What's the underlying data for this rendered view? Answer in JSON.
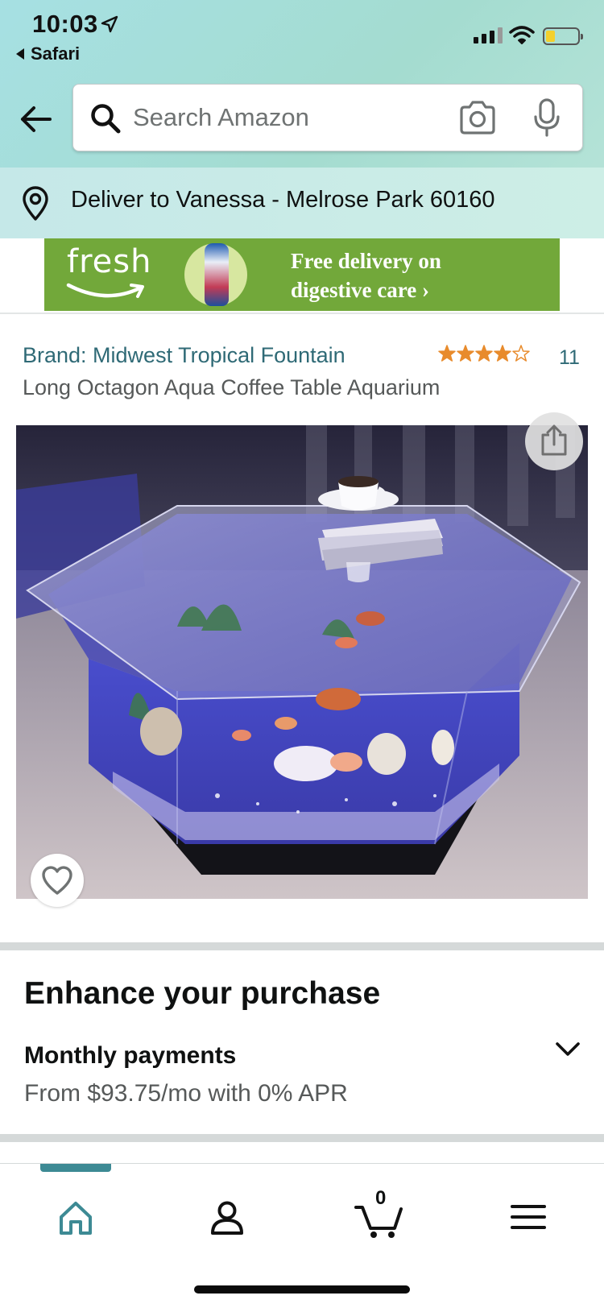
{
  "status_bar": {
    "time": "10:03",
    "back_app": "Safari"
  },
  "search": {
    "placeholder": "Search Amazon"
  },
  "delivery": {
    "text": "Deliver to Vanessa - Melrose Park 60160"
  },
  "banner": {
    "logo_text": "fresh",
    "line1": "Free delivery on",
    "line2": "digestive care ›",
    "colors": {
      "background": "#72a83a"
    }
  },
  "product": {
    "brand": "Brand: Midwest Tropical Fountain",
    "title": "Long Octagon Aqua Coffee Table Aquarium",
    "rating_stars": 4,
    "rating_max": 5,
    "rating_count": "11"
  },
  "enhance": {
    "heading": "Enhance your purchase",
    "monthly_title": "Monthly payments",
    "monthly_sub": "From $93.75/mo with 0% APR"
  },
  "bottom_nav": {
    "items": [
      {
        "icon": "home-icon",
        "active": true
      },
      {
        "icon": "account-icon",
        "active": false
      },
      {
        "icon": "cart-icon",
        "active": false
      },
      {
        "icon": "menu-icon",
        "active": false
      }
    ],
    "cart_count": "0"
  },
  "colors": {
    "link": "#2f6a76",
    "star": "#e88b2c",
    "accent": "#3d8a94"
  }
}
